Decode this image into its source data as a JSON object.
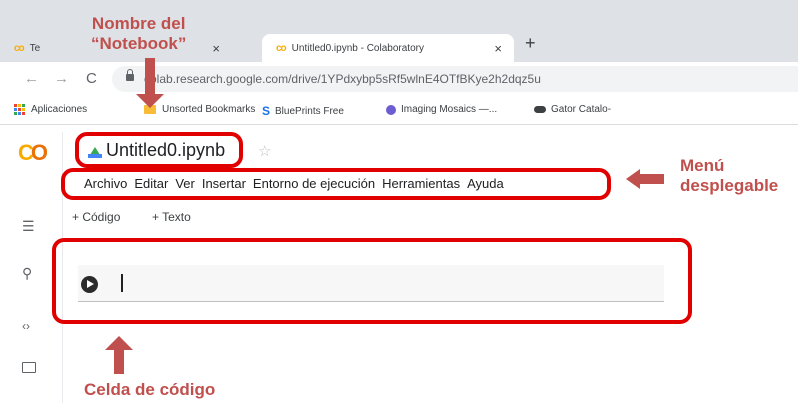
{
  "browser": {
    "tabs": [
      {
        "label": "Te"
      },
      {
        "label": "Untitled0.ipynb - Colaboratory"
      }
    ],
    "tab_close": "×",
    "new_tab": "+",
    "address": "colab.research.google.com/drive/1YPdxybp5sRf5wlnE4OTfBKye2h2dqz5u",
    "bookmarks": [
      "Aplicaciones",
      "Unsorted Bookmarks",
      "BluePrints Free",
      "Imaging Mosaics —...",
      "Gator Catalo-"
    ],
    "bp_glyph": "S"
  },
  "colab": {
    "logo_left": "C",
    "logo_right": "O",
    "notebook_title": "Untitled0.ipynb",
    "menu": [
      "Archivo",
      "Editar",
      "Ver",
      "Insertar",
      "Entorno de ejecución",
      "Herramientas",
      "Ayuda"
    ],
    "toolbar": {
      "code": "+ Código",
      "text": "+ Texto"
    }
  },
  "annotations": {
    "notebook_name": "Nombre del\n“Notebook”",
    "menu": "Menú\ndesplegable",
    "code_cell": "Celda de código"
  },
  "colors": {
    "annotation": "#c0504d",
    "highlight_box": "#e00000",
    "colab_orange": "#f9ab00"
  }
}
